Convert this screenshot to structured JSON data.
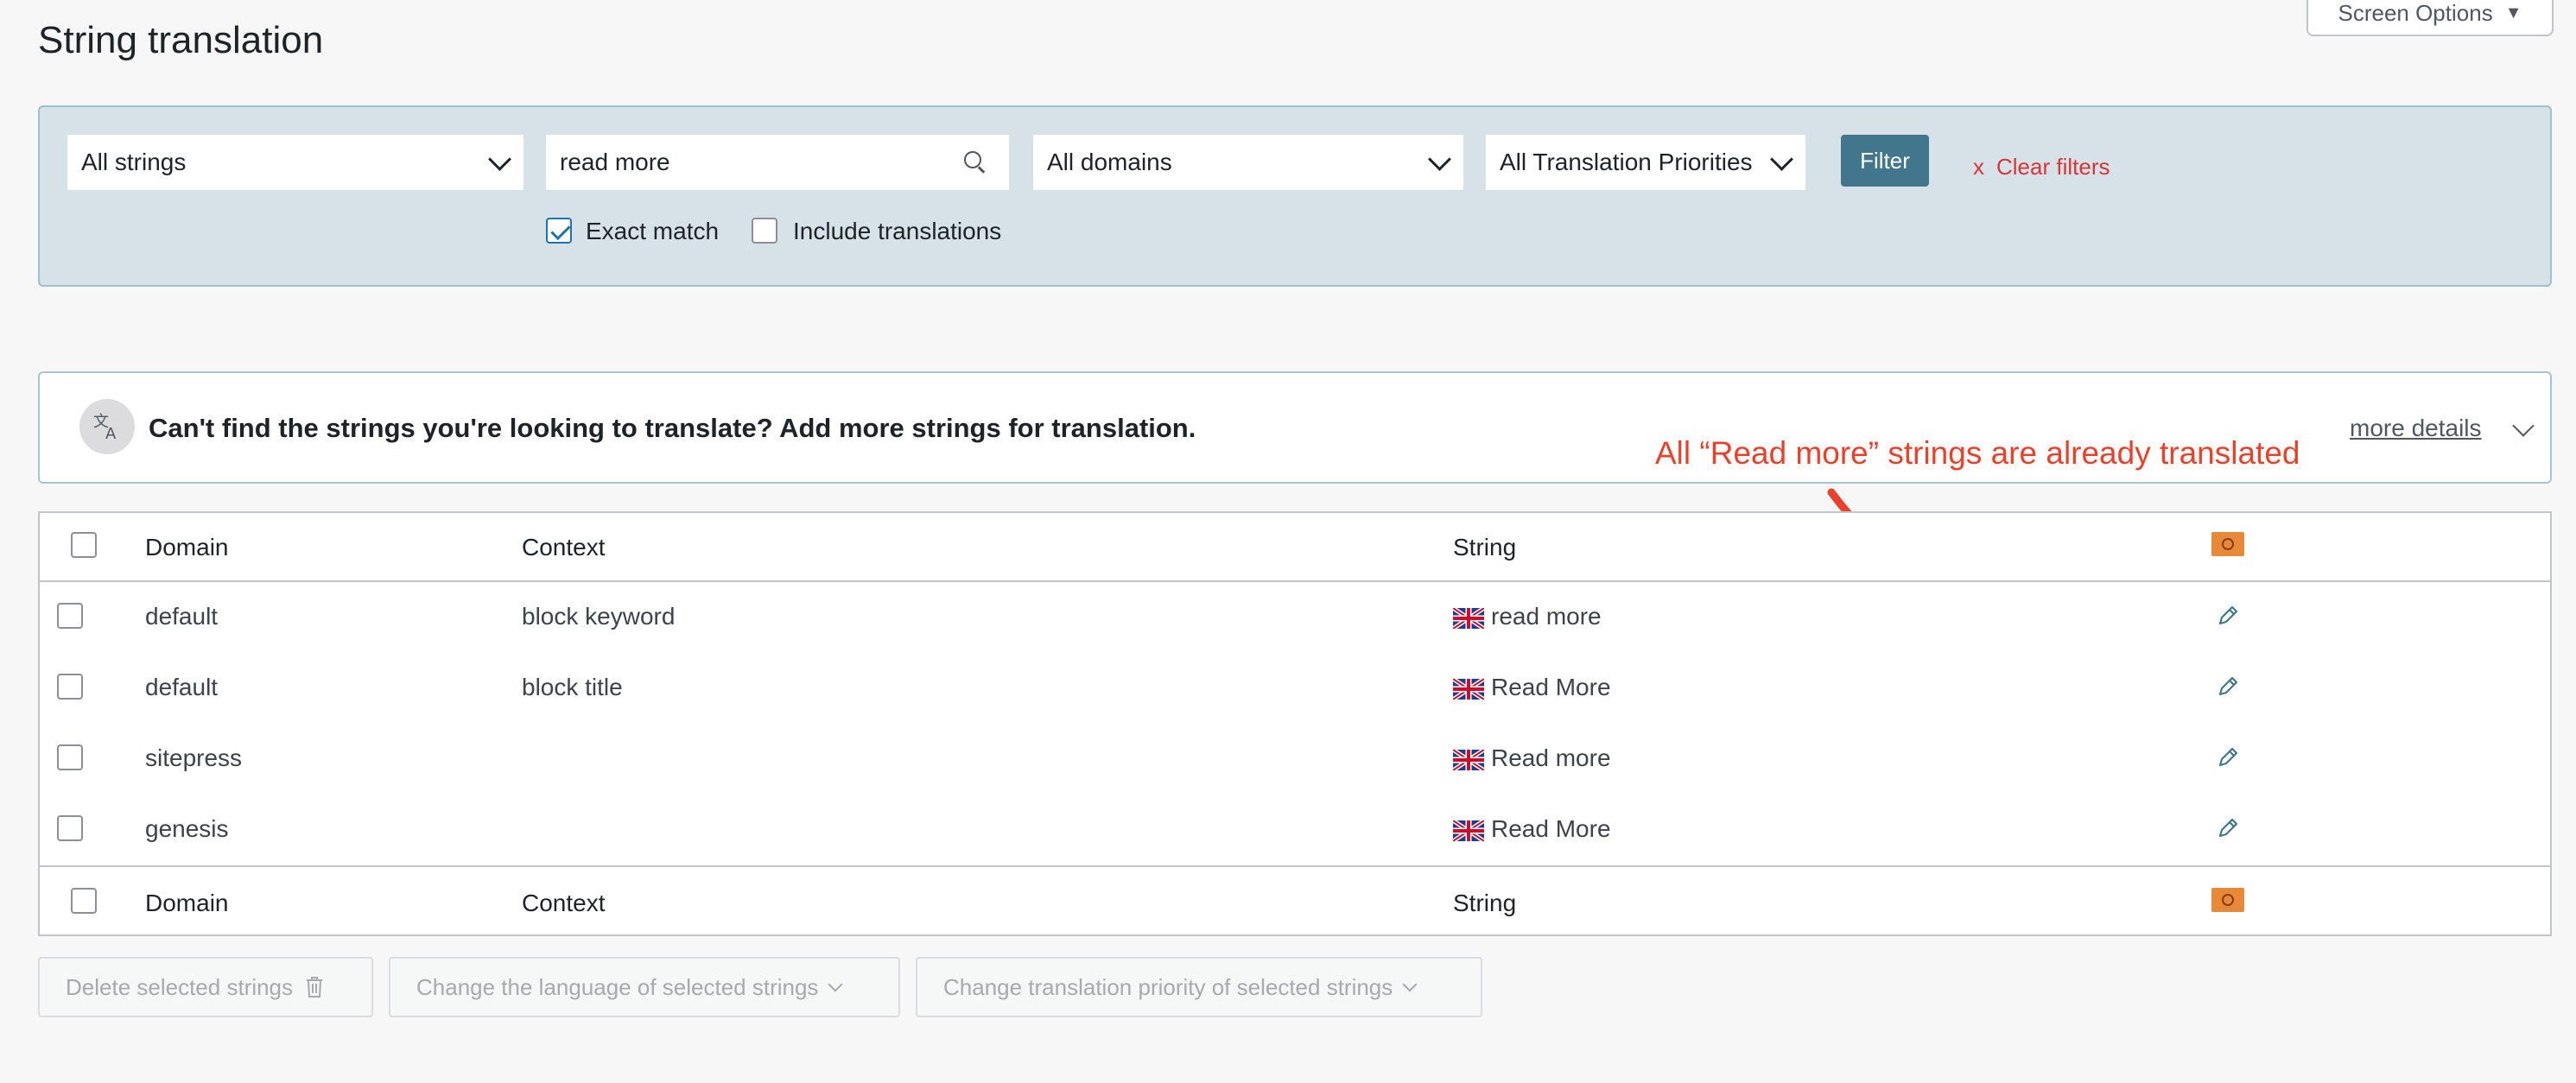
{
  "page": {
    "title": "String translation",
    "screen_options": "Screen Options"
  },
  "filters": {
    "string_type": "All strings",
    "search_value": "read more",
    "domain": "All domains",
    "priority": "All Translation Priorities",
    "filter_button": "Filter",
    "clear_x": "x",
    "clear_label": "Clear filters",
    "exact_match": {
      "label": "Exact match",
      "checked": true
    },
    "include_translations": {
      "label": "Include translations",
      "checked": false
    }
  },
  "notice": {
    "icon": "translate-icon",
    "text": "Can't find the strings you're looking to translate? Add more strings for translation.",
    "more_details": "more details"
  },
  "annotation": {
    "text": "All “Read more” strings are already translated",
    "color": "#e8412c"
  },
  "table": {
    "columns": {
      "domain": "Domain",
      "context": "Context",
      "string": "String"
    },
    "rows": [
      {
        "domain": "default",
        "context": "block keyword",
        "string": "read more"
      },
      {
        "domain": "default",
        "context": "block title",
        "string": "Read More"
      },
      {
        "domain": "sitepress",
        "context": "",
        "string": "Read more"
      },
      {
        "domain": "genesis",
        "context": "",
        "string": "Read More"
      }
    ]
  },
  "bulk_actions": {
    "delete": "Delete selected strings",
    "change_language": "Change the language of selected strings",
    "change_priority": "Change translation priority of selected strings"
  }
}
